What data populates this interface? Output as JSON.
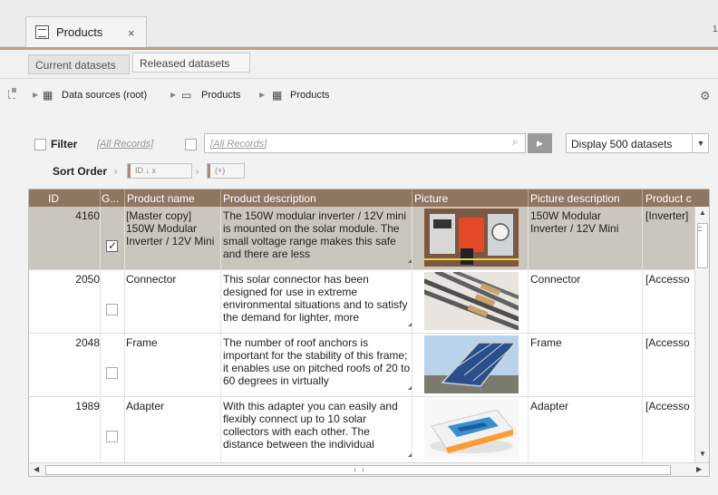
{
  "tabbar": {
    "tab_label": "Products",
    "close_glyph": "×",
    "right_text": "1"
  },
  "dataset_tabs": {
    "current": "Current datasets",
    "released": "Released datasets"
  },
  "breadcrumb": {
    "root": "Data sources (root)",
    "folder": "Products",
    "table": "Products"
  },
  "filter": {
    "label": "Filter",
    "all_records_1": "[All Records]",
    "search_value": "[All Records]",
    "display_value": "Display 500 datasets"
  },
  "sort": {
    "label": "Sort Order",
    "chip1": "ID  ↓ x",
    "chip2": "(+)"
  },
  "table": {
    "columns": [
      "ID",
      "G...",
      "Product name",
      "Product description",
      "Picture",
      "Picture description",
      "Product c"
    ],
    "rows": [
      {
        "id": "4160",
        "checked": true,
        "name": "[Master copy] 150W Modular Inverter / 12V Mini",
        "description": "The 150W modular inverter / 12V mini is mounted on the solar module. The small voltage range makes this safe and there are less",
        "picture": "inverter",
        "picture_description": "150W Modular Inverter / 12V Mini",
        "category": "[Inverter]"
      },
      {
        "id": "2050",
        "checked": false,
        "name": "Connector",
        "description": "This solar connector has been designed for use in extreme environmental situations and to satisfy the demand for lighter, more",
        "picture": "connector",
        "picture_description": "Connector",
        "category": "[Accesso"
      },
      {
        "id": "2048",
        "checked": false,
        "name": "Frame",
        "description": "The number of roof anchors is important for the stability of this frame; it enables use on pitched roofs of 20 to 60 degrees in virtually",
        "picture": "frame",
        "picture_description": "Frame",
        "category": "[Accesso"
      },
      {
        "id": "1989",
        "checked": false,
        "name": "Adapter",
        "description": "With this adapter you can easily and flexibly connect up to 10 solar collectors with each other. The distance between the individual",
        "picture": "adapter",
        "picture_description": "Adapter",
        "category": "[Accesso"
      }
    ]
  },
  "colors": {
    "header_brown": "#8f7661",
    "selected_row": "#cac6bd"
  }
}
